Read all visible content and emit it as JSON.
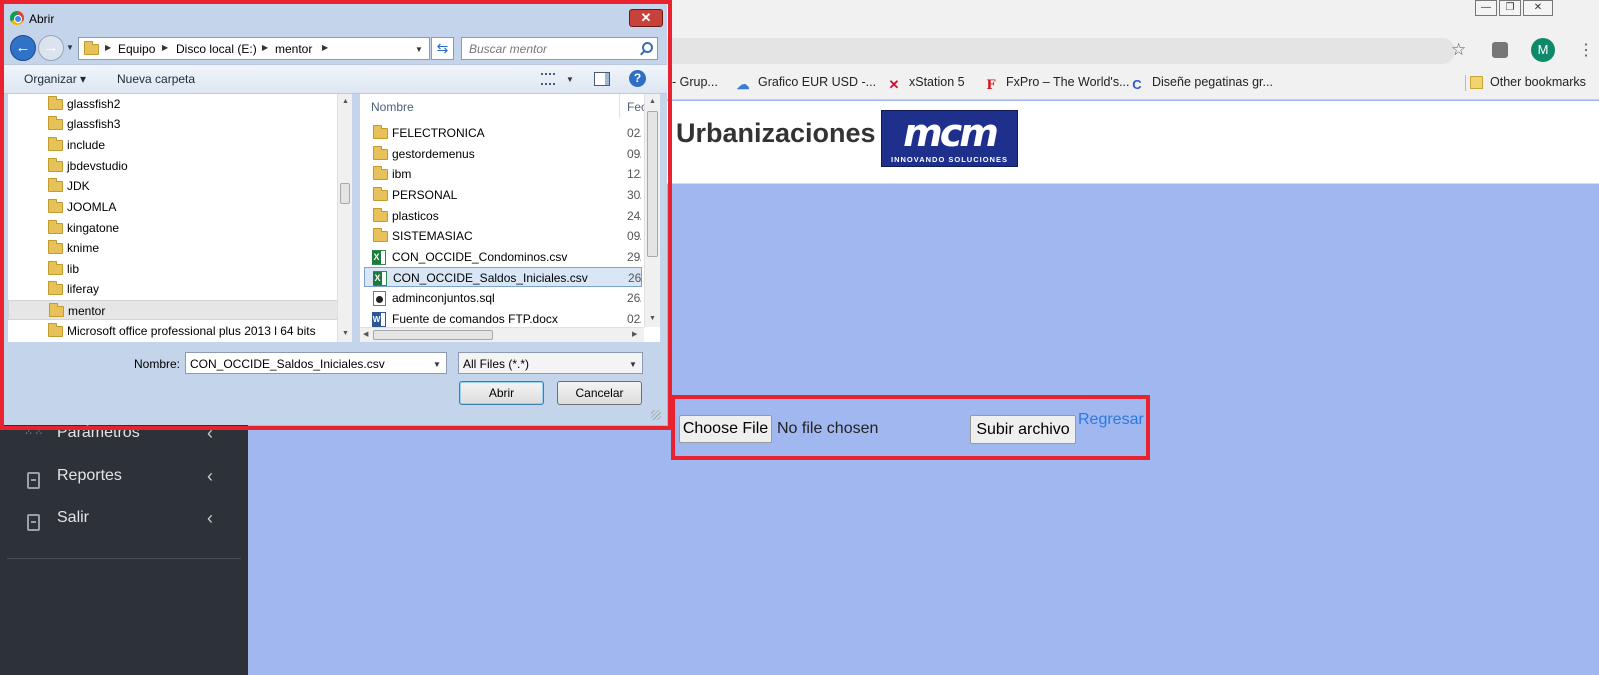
{
  "browser": {
    "window_controls": [
      "—",
      "❐",
      "✕"
    ],
    "profile_initial": "M",
    "bookmarks": [
      {
        "label": "- Grup...",
        "icon": "blank"
      },
      {
        "label": "Grafico EUR USD -...",
        "icon": "cloud-icon"
      },
      {
        "label": "xStation 5",
        "icon": "x-icon"
      },
      {
        "label": "FxPro – The World's...",
        "icon": "f-icon"
      },
      {
        "label": "Diseñe pegatinas gr...",
        "icon": "c-icon"
      },
      {
        "label": "Other bookmarks",
        "icon": "folder-icon"
      }
    ]
  },
  "page": {
    "title": "Urbanizaciones",
    "logo": {
      "mark": "mcm",
      "tagline": "INNOVANDO SOLUCIONES"
    },
    "sidebar": {
      "items": [
        {
          "label": "Parámetros",
          "icon": "dots-grid-icon"
        },
        {
          "label": "Reportes",
          "icon": "document-icon"
        },
        {
          "label": "Salir",
          "icon": "document-icon"
        }
      ],
      "chevron": "‹"
    },
    "upload": {
      "choose_label": "Choose File",
      "status": "No file chosen",
      "submit_label": "Subir archivo",
      "back_link": "Regresar"
    }
  },
  "dialog": {
    "title": "Abrir",
    "close": "✕",
    "breadcrumb": [
      "Equipo",
      "Disco local (E:)",
      "mentor"
    ],
    "search_placeholder": "Buscar mentor",
    "commands": {
      "organize": "Organizar ▾",
      "new_folder": "Nueva carpeta"
    },
    "nav_folders": [
      "glassfish2",
      "glassfish3",
      "include",
      "jbdevstudio",
      "JDK",
      "JOOMLA",
      "kingatone",
      "knime",
      "lib",
      "liferay",
      "mentor",
      "Microsoft office professional plus 2013 l 64 bits"
    ],
    "nav_selected": "mentor",
    "columns": {
      "name": "Nombre",
      "date": "Fec"
    },
    "files": [
      {
        "name": "FELECTRONICA",
        "type": "folder",
        "date": "02/"
      },
      {
        "name": "gestordemenus",
        "type": "folder",
        "date": "09/"
      },
      {
        "name": "ibm",
        "type": "folder",
        "date": "12/"
      },
      {
        "name": "PERSONAL",
        "type": "folder",
        "date": "30/"
      },
      {
        "name": "plasticos",
        "type": "folder",
        "date": "24/"
      },
      {
        "name": "SISTEMASIAC",
        "type": "folder",
        "date": "09/"
      },
      {
        "name": "CON_OCCIDE_Condominos.csv",
        "type": "csv",
        "date": "29/"
      },
      {
        "name": "CON_OCCIDE_Saldos_Iniciales.csv",
        "type": "csv",
        "date": "26/"
      },
      {
        "name": "adminconjuntos.sql",
        "type": "sql",
        "date": "26/"
      },
      {
        "name": "Fuente de comandos FTP.docx",
        "type": "docx",
        "date": "02/"
      }
    ],
    "selected_file": "CON_OCCIDE_Saldos_Iniciales.csv",
    "name_label": "Nombre:",
    "name_value": "CON_OCCIDE_Saldos_Iniciales.csv",
    "filter_value": "All Files (*.*)",
    "open_label": "Abrir",
    "cancel_label": "Cancelar"
  }
}
